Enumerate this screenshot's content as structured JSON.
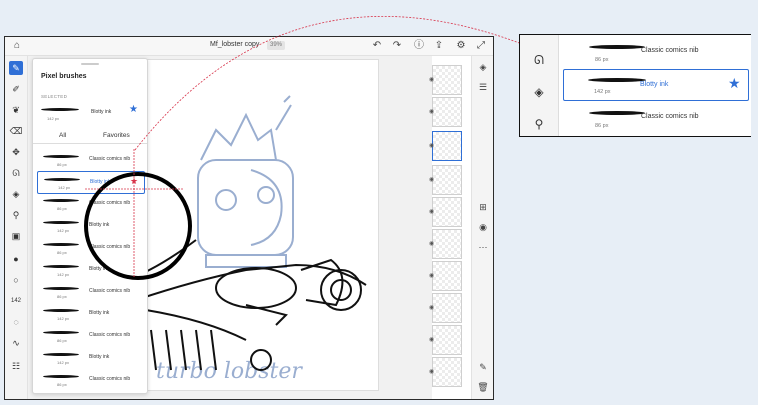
{
  "app": {
    "title": "Mf_lobster copy",
    "zoom": "39%"
  },
  "panel": {
    "title": "Pixel brushes",
    "selected_label": "SELECTED",
    "selected": {
      "name": "Blotty ink",
      "size": "142 px"
    },
    "tabs": [
      "All",
      "Favorites"
    ],
    "brushes": [
      {
        "name": "Classic comics nib",
        "size": "86 px"
      },
      {
        "name": "Blotty ink",
        "size": "142 px"
      },
      {
        "name": "Classic comics nib",
        "size": "86 px"
      },
      {
        "name": "Blotty ink",
        "size": "142 px"
      },
      {
        "name": "Classic comics nib",
        "size": "86 px"
      },
      {
        "name": "Blotty ink",
        "size": "142 px"
      },
      {
        "name": "Classic comics nib",
        "size": "86 px"
      },
      {
        "name": "Blotty ink",
        "size": "142 px"
      },
      {
        "name": "Classic comics nib",
        "size": "86 px"
      },
      {
        "name": "Blotty ink",
        "size": "142 px"
      },
      {
        "name": "Classic comics nib",
        "size": "86 px"
      }
    ]
  },
  "tool_value": "142",
  "canvas_text": "turbo lobster",
  "callout": {
    "items": [
      {
        "name": "Classic comics nib",
        "size": "86 px"
      },
      {
        "name": "Blotty ink",
        "size": "142 px"
      },
      {
        "name": "Classic comics nib",
        "size": "86 px"
      }
    ]
  },
  "colors": {
    "accent": "#2f6fd6",
    "guide": "#d8344a",
    "sketch": "#9aaed0"
  },
  "icons": [
    "home-icon",
    "undo-icon",
    "redo-icon",
    "help-icon",
    "share-icon",
    "settings-icon",
    "fullscreen-icon",
    "brush-icon",
    "smudge-icon",
    "eraser-icon",
    "transform-icon",
    "lasso-icon",
    "fill-icon",
    "eyedropper-icon",
    "image-icon",
    "layers-icon",
    "eye-icon",
    "more-icon",
    "star-icon"
  ]
}
